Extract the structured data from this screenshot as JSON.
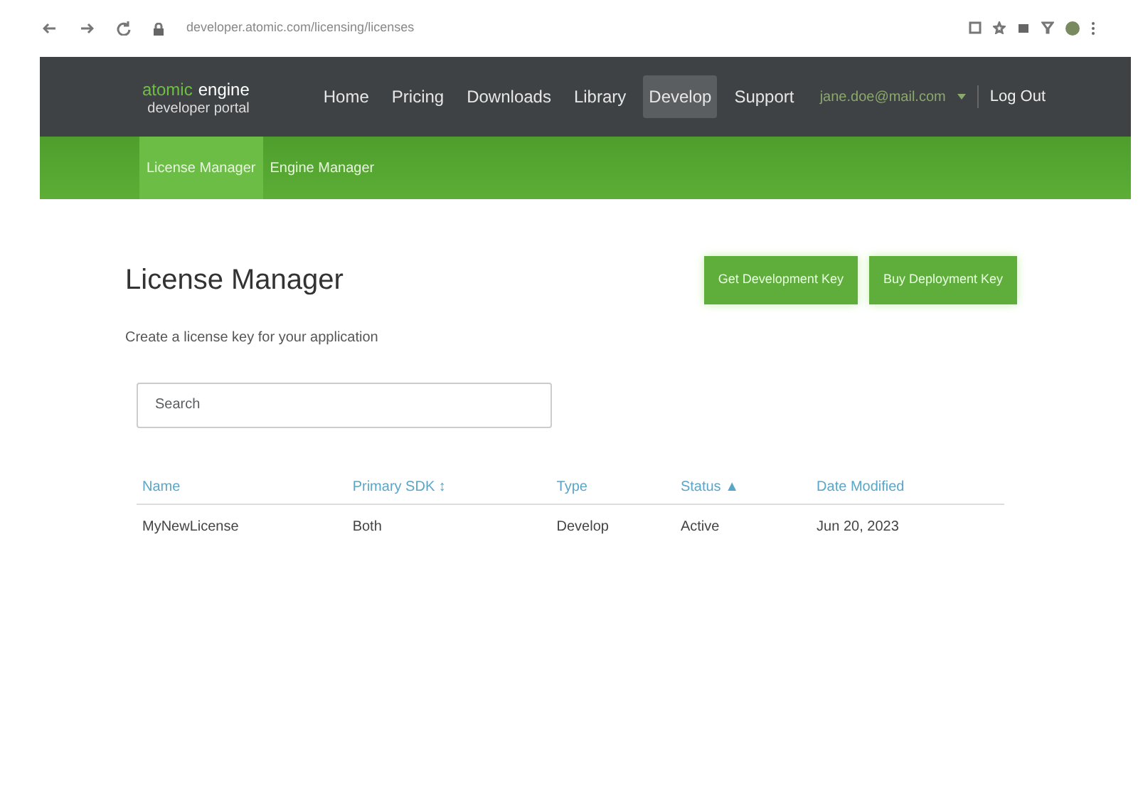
{
  "browser": {
    "url": "developer.atomic.com/licensing/licenses"
  },
  "brand": {
    "accent": "atomic",
    "name": "engine",
    "subtitle": "developer portal"
  },
  "nav": [
    {
      "label": "Home",
      "selected": false
    },
    {
      "label": "Pricing",
      "selected": false
    },
    {
      "label": "Downloads",
      "selected": false
    },
    {
      "label": "Library",
      "selected": false
    },
    {
      "label": "Develop",
      "selected": true
    },
    {
      "label": "Support",
      "selected": false
    }
  ],
  "user": {
    "name": "jane.doe@mail.com",
    "logout": "Log Out"
  },
  "subnav": [
    {
      "label": "License Manager",
      "selected": true
    },
    {
      "label": "Engine Manager",
      "selected": false
    }
  ],
  "page": {
    "title": "License Manager",
    "description": "Create a license key for your application",
    "buttons": [
      "Get Development Key",
      "Buy Deployment Key"
    ]
  },
  "search": {
    "placeholder": "Search"
  },
  "table": {
    "columns": [
      {
        "label": "Name"
      },
      {
        "label": "Primary SDK",
        "sort": "↕"
      },
      {
        "label": "Type"
      },
      {
        "label": "Status",
        "sort": "▲"
      },
      {
        "label": "Date Modified"
      }
    ],
    "rows": [
      [
        "MyNewLicense",
        "Both",
        "Develop",
        "Active",
        "Jun 20, 2023"
      ]
    ]
  }
}
